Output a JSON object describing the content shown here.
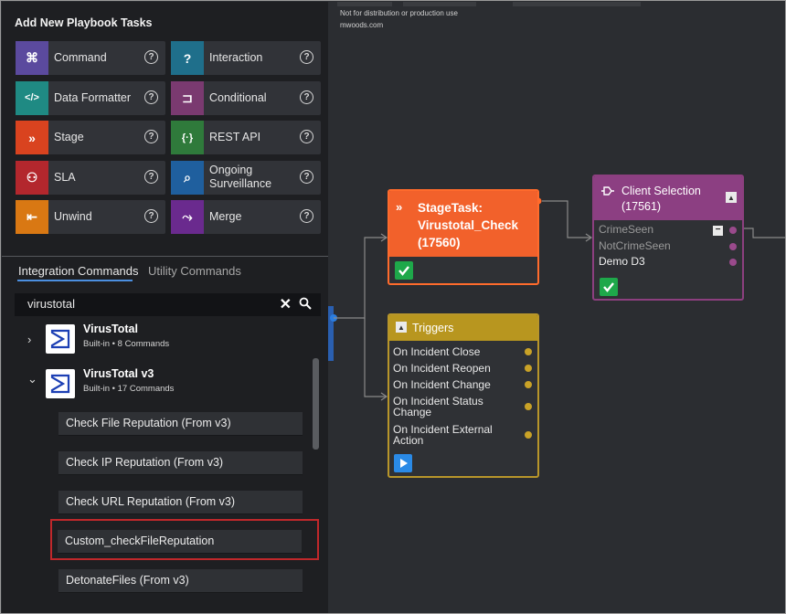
{
  "left_panel": {
    "title": "Add New Playbook Tasks",
    "tasks": [
      {
        "label": "Command",
        "color": "#5b4a9e",
        "icon": "command-icon"
      },
      {
        "label": "Interaction",
        "color": "#1f6f8b",
        "icon": "chat-question-icon"
      },
      {
        "label": "Data Formatter",
        "color": "#1f8a83",
        "icon": "code-icon"
      },
      {
        "label": "Conditional",
        "color": "#7a3a70",
        "icon": "condition-icon"
      },
      {
        "label": "Stage",
        "color": "#d9431f",
        "icon": "stage-chevrons-icon"
      },
      {
        "label": "REST API",
        "color": "#2f7a3b",
        "icon": "rest-api-braces-icon"
      },
      {
        "label": "SLA",
        "color": "#b3272d",
        "icon": "handshake-icon"
      },
      {
        "label": "Ongoing Surveillance",
        "color": "#1f5f9e",
        "icon": "surveillance-search-icon"
      },
      {
        "label": "Unwind",
        "color": "#d97813",
        "icon": "unwind-icon"
      },
      {
        "label": "Merge",
        "color": "#6a2a8e",
        "icon": "merge-icon"
      }
    ],
    "help_glyph": "?",
    "tabs": {
      "integration": "Integration Commands",
      "utility": "Utility Commands"
    },
    "search": {
      "value": "virustotal",
      "clear_glyph": "✕"
    },
    "integrations": [
      {
        "name": "VirusTotal",
        "meta": "Built-in  • 8 Commands",
        "chevron": "›"
      },
      {
        "name": "VirusTotal v3",
        "meta": "Built-in  • 17 Commands",
        "chevron": "⌄"
      }
    ],
    "commands": [
      "Check File Reputation (From v3)",
      "Check IP Reputation (From v3)",
      "Check URL Reputation (From v3)",
      "Custom_checkFileReputation",
      "DetonateFiles (From v3)"
    ]
  },
  "canvas": {
    "watermark_line1": "Not for distribution or production use",
    "watermark_line2": "mwoods.com",
    "stage_node": {
      "icon_glyph": "»",
      "title": "StageTask: Virustotal_Check (17560)"
    },
    "triggers_node": {
      "title": "Triggers",
      "items": [
        "On Incident Close",
        "On Incident Reopen",
        "On Incident Change",
        "On Incident Status Change",
        "On Incident External Action"
      ]
    },
    "client_selection_node": {
      "title": "Client Selection",
      "id": "(17561)",
      "branches": [
        {
          "label": "CrimeSeen",
          "color": "#9a9a9a"
        },
        {
          "label": "NotCrimeSeen",
          "color": "#9a9a9a"
        },
        {
          "label": "Demo D3",
          "color": "#f0f0f0"
        }
      ]
    }
  }
}
